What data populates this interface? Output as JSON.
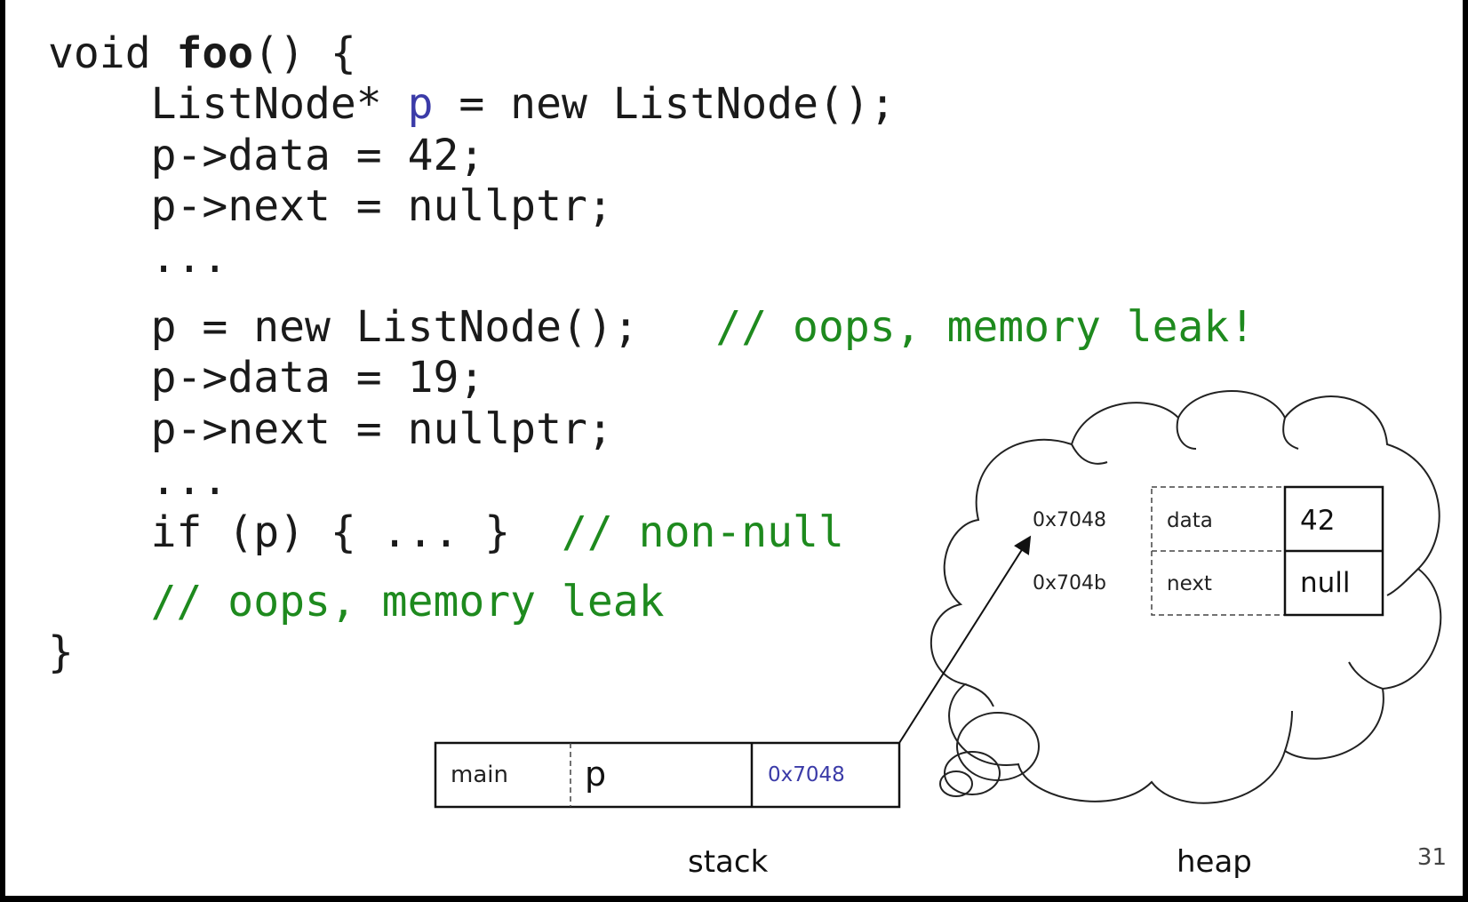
{
  "code": {
    "line1": {
      "a": "void ",
      "b": "foo",
      "c": "() {"
    },
    "line2": {
      "a": "    ListNode* ",
      "b": "p",
      "c": " = new ListNode();"
    },
    "line3": "    p->data = 42;",
    "line4": "    p->next = nullptr;",
    "line5": "    ...",
    "line6": {
      "a": "    p = new ListNode();   ",
      "b": "// oops, memory leak!"
    },
    "line7": "    p->data = 19;",
    "line8": "    p->next = nullptr;",
    "line9": "    ...",
    "line10": {
      "a": "    if (p) { ... }  ",
      "b": "// non-null"
    },
    "line11": {
      "a": "    ",
      "b": "// oops, memory leak"
    },
    "line12": "}"
  },
  "heap": {
    "addr_data": "0x7048",
    "addr_next": "0x704b",
    "field_data": "data",
    "field_next": "next",
    "value_data": "42",
    "value_next": "null",
    "caption": "heap"
  },
  "stack": {
    "frame": "main",
    "var": "p",
    "value": "0x7048",
    "caption": "stack"
  },
  "page_number": "31",
  "colors": {
    "identifier": "#3b3ba8",
    "comment": "#1e8a1e",
    "text": "#1a1a1a"
  }
}
